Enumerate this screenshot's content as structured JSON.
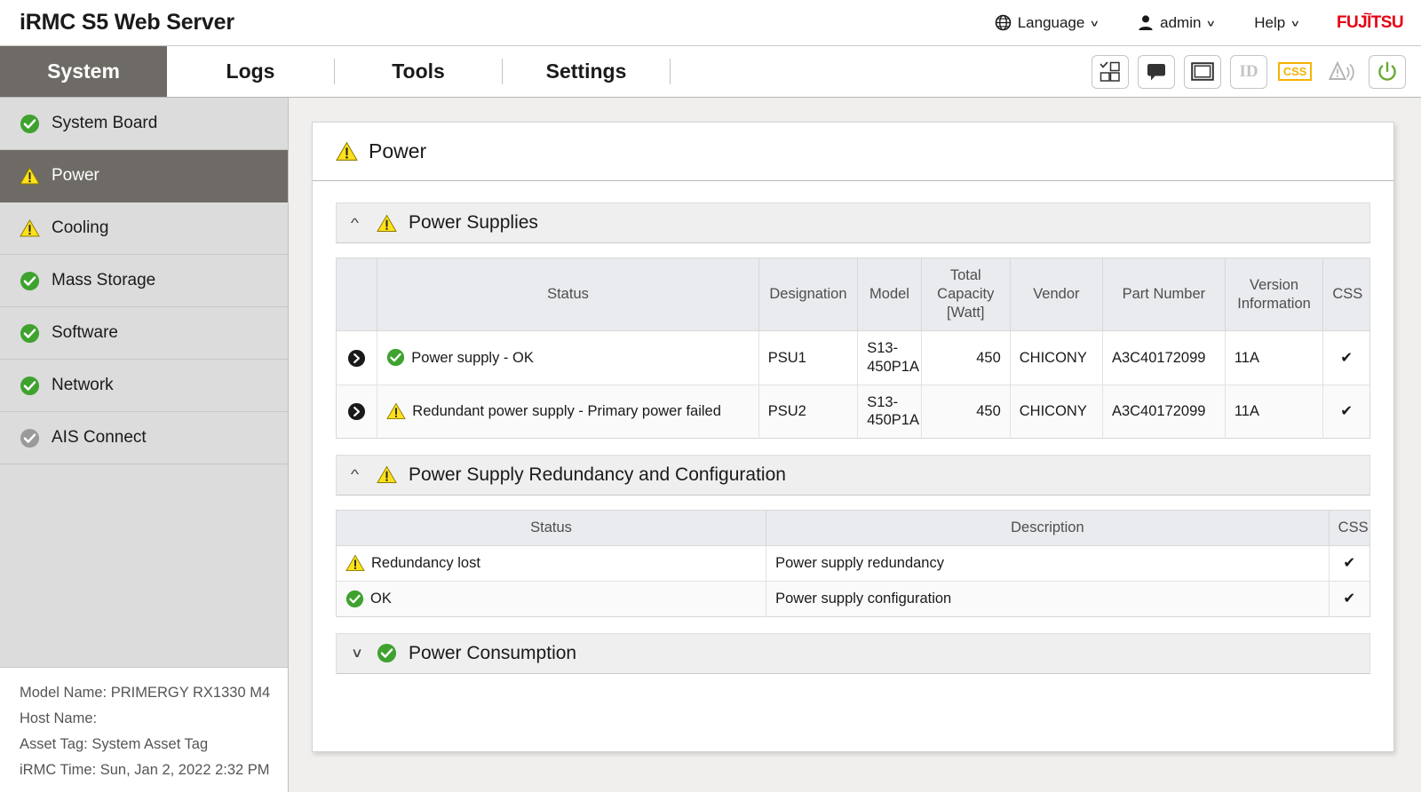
{
  "header": {
    "app_title": "iRMC S5 Web Server",
    "language_label": "Language",
    "user_label": "admin",
    "help_label": "Help",
    "brand": "FUJITSU",
    "icons": {
      "globe": "globe-icon",
      "user": "user-icon",
      "caret": "chevron-down-icon"
    }
  },
  "nav": {
    "tabs": [
      {
        "label": "System",
        "active": true
      },
      {
        "label": "Logs",
        "active": false
      },
      {
        "label": "Tools",
        "active": false
      },
      {
        "label": "Settings",
        "active": false
      }
    ],
    "tools": [
      {
        "name": "dashboard-icon",
        "label": ""
      },
      {
        "name": "console-icon",
        "label": ""
      },
      {
        "name": "video-redirection-icon",
        "label": ""
      },
      {
        "name": "identify-led-icon",
        "label": "ID"
      },
      {
        "name": "css-led-icon",
        "label": "CSS"
      },
      {
        "name": "global-error-led-icon",
        "label": ""
      },
      {
        "name": "power-button-icon",
        "label": ""
      }
    ]
  },
  "sidebar": {
    "items": [
      {
        "label": "System Board",
        "status": "ok"
      },
      {
        "label": "Power",
        "status": "warning",
        "active": true
      },
      {
        "label": "Cooling",
        "status": "warning"
      },
      {
        "label": "Mass Storage",
        "status": "ok"
      },
      {
        "label": "Software",
        "status": "ok"
      },
      {
        "label": "Network",
        "status": "ok"
      },
      {
        "label": "AIS Connect",
        "status": "disabled"
      }
    ],
    "footer": {
      "model_name": "Model Name: PRIMERGY RX1330 M4",
      "host_name": "Host Name:",
      "asset_tag": "Asset Tag: System Asset Tag",
      "irmc_time": "iRMC Time: Sun, Jan 2, 2022 2:32 PM"
    }
  },
  "page": {
    "title": "Power",
    "title_status": "warning"
  },
  "sections": {
    "power_supplies": {
      "title": "Power Supplies",
      "status": "warning",
      "expanded": true,
      "columns": [
        "",
        "Status",
        "Designation",
        "Model",
        "Total Capacity [Watt]",
        "Vendor",
        "Part Number",
        "Version Information",
        "CSS"
      ],
      "rows": [
        {
          "status_icon": "ok",
          "status": "Power supply - OK",
          "designation": "PSU1",
          "model": "S13-450P1A",
          "capacity": "450",
          "vendor": "CHICONY",
          "part_number": "A3C40172099",
          "version": "11A",
          "css": "✔"
        },
        {
          "status_icon": "warning",
          "status": "Redundant power supply - Primary power failed",
          "designation": "PSU2",
          "model": "S13-450P1A",
          "capacity": "450",
          "vendor": "CHICONY",
          "part_number": "A3C40172099",
          "version": "11A",
          "css": "✔"
        }
      ]
    },
    "redundancy": {
      "title": "Power Supply Redundancy and Configuration",
      "status": "warning",
      "expanded": true,
      "columns": [
        "Status",
        "Description",
        "CSS"
      ],
      "rows": [
        {
          "status_icon": "warning",
          "status": "Redundancy lost",
          "description": "Power supply redundancy",
          "css": "✔"
        },
        {
          "status_icon": "ok",
          "status": "OK",
          "description": "Power supply configuration",
          "css": "✔"
        }
      ]
    },
    "power_consumption": {
      "title": "Power Consumption",
      "status": "ok",
      "expanded": false
    }
  },
  "colors": {
    "ok_green": "#3fa22f",
    "warning_yellow": "#ffe11a",
    "disabled_gray": "#9a9a9a",
    "brand_red": "#e60012",
    "css_amber": "#f5b200",
    "active_tab": "#6e6a65"
  }
}
